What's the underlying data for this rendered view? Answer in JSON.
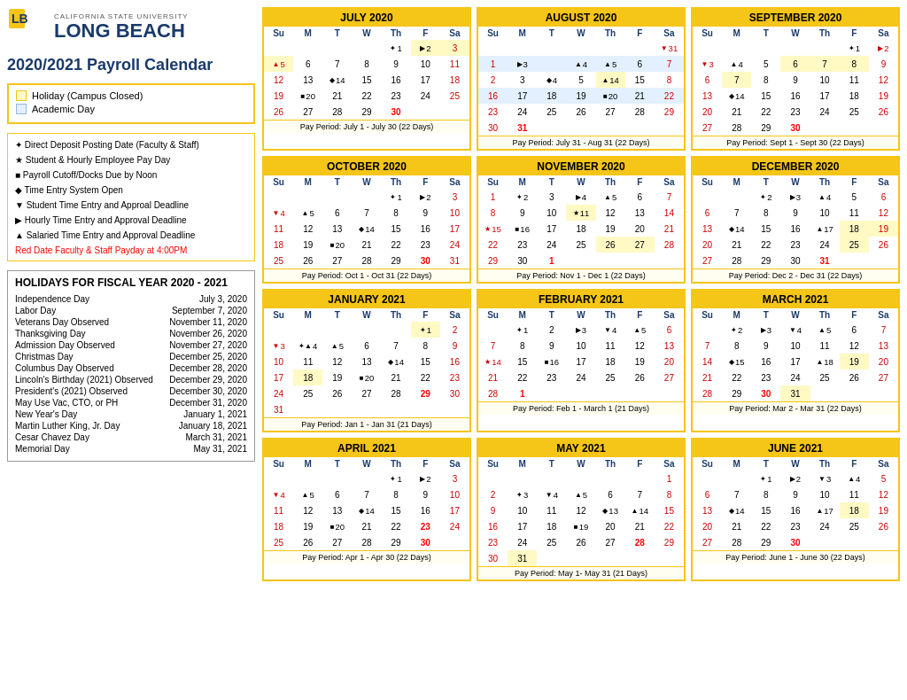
{
  "sidebar": {
    "logo_sub": "CALIFORNIA STATE UNIVERSITY",
    "logo_main": "LONG BEACH",
    "title": "2020/2021 Payroll Calendar",
    "legend": {
      "holiday_label": "Holiday (Campus Closed)",
      "academic_label": "Academic Day"
    },
    "symbols": [
      {
        "sym": "✦",
        "label": "Direct Deposit Posting Date (Faculty & Staff)"
      },
      {
        "sym": "★",
        "label": "Student & Hourly Employee Pay Day"
      },
      {
        "sym": "■",
        "label": "Payroll Cutoff/Docks Due by Noon"
      },
      {
        "sym": "◆",
        "label": "Time Entry System Open"
      },
      {
        "sym": "▼",
        "label": "Student Time Entry and Approal Deadline"
      },
      {
        "sym": "▶",
        "label": "Hourly Time Entry and Approval Deadline"
      },
      {
        "sym": "▲",
        "label": "Salaried Time Entry and Approval Deadline"
      }
    ],
    "red_note": "Red Date  Faculty & Staff Payday at 4:00PM",
    "holidays_title": "HOLIDAYS FOR FISCAL YEAR 2020 - 2021",
    "holidays": [
      {
        "name": "Independence Day",
        "date": "July 3, 2020"
      },
      {
        "name": "Labor Day",
        "date": "September 7, 2020"
      },
      {
        "name": "Veterans Day Observed",
        "date": "November 11, 2020"
      },
      {
        "name": "Thanksgiving Day",
        "date": "November 26, 2020"
      },
      {
        "name": "Admission Day Observed",
        "date": "November 27, 2020"
      },
      {
        "name": "Christmas Day",
        "date": "December 25, 2020"
      },
      {
        "name": "Columbus Day Observed",
        "date": "December 28, 2020"
      },
      {
        "name": "Lincoln's Birthday (2021) Observed",
        "date": "December 29, 2020"
      },
      {
        "name": "President's (2021) Observed",
        "date": "December 30, 2020"
      },
      {
        "name": "May Use Vac, CTO, or PH",
        "date": "December 31, 2020"
      },
      {
        "name": "New Year's Day",
        "date": "January 1, 2021"
      },
      {
        "name": "Martin Luther King, Jr. Day",
        "date": "January 18, 2021"
      },
      {
        "name": "Cesar Chavez Day",
        "date": "March 31, 2021"
      },
      {
        "name": "Memorial Day",
        "date": "May 31, 2021"
      }
    ]
  },
  "calendar": {
    "months": [
      {
        "name": "JULY 2020",
        "pay_period": "Pay Period: July 1 - July 30 (22 Days)"
      },
      {
        "name": "AUGUST 2020",
        "pay_period": "Pay Period: July 31 - Aug 31 (22 Days)"
      },
      {
        "name": "SEPTEMBER 2020",
        "pay_period": "Pay Period: Sept 1 - Sept 30 (22 Days)"
      },
      {
        "name": "OCTOBER 2020",
        "pay_period": "Pay Period: Oct 1 - Oct 31 (22 Days)"
      },
      {
        "name": "NOVEMBER 2020",
        "pay_period": "Pay Period: Nov 1 - Dec 1 (22 Days)"
      },
      {
        "name": "DECEMBER 2020",
        "pay_period": "Pay Period: Dec 2 - Dec 31 (22 Days)"
      },
      {
        "name": "JANUARY 2021",
        "pay_period": "Pay Period: Jan 1 - Jan 31 (21 Days)"
      },
      {
        "name": "FEBRUARY 2021",
        "pay_period": "Pay Period: Feb 1 - March 1 (21 Days)"
      },
      {
        "name": "MARCH 2021",
        "pay_period": "Pay Period: Mar 2 - Mar 31 (22 Days)"
      },
      {
        "name": "APRIL 2021",
        "pay_period": "Pay Period: Apr 1 - Apr 30 (22 Days)"
      },
      {
        "name": "MAY 2021",
        "pay_period": "Pay Period: May 1- May 31 (21 Days)"
      },
      {
        "name": "JUNE 2021",
        "pay_period": "Pay Period: June 1 - June 30 (22 Days)"
      }
    ]
  }
}
